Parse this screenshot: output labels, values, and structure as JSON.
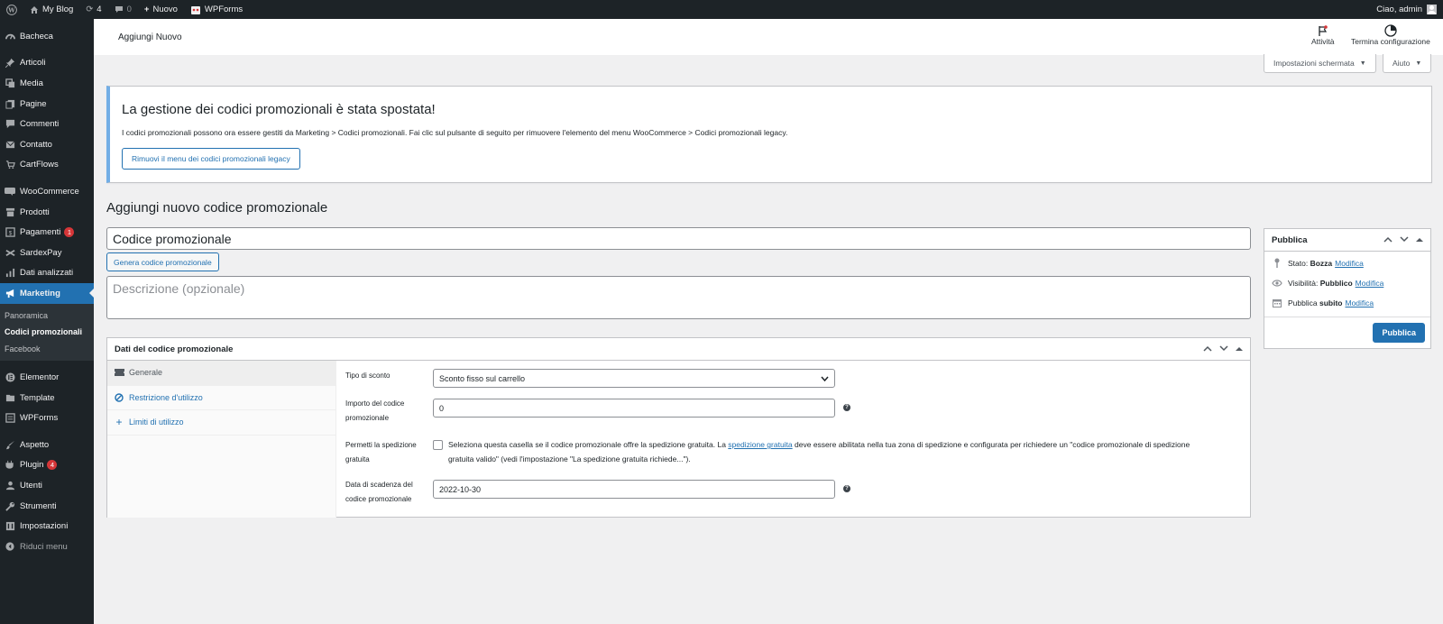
{
  "adminbar": {
    "site_name": "My Blog",
    "updates_count": "4",
    "comments_count": "0",
    "new_label": "Nuovo",
    "wpforms_label": "WPForms",
    "greeting": "Ciao, admin"
  },
  "sidebar": {
    "items": [
      {
        "label": "Bacheca",
        "icon": "dashboard-icon"
      },
      {
        "label": "Articoli",
        "icon": "pin-icon"
      },
      {
        "label": "Media",
        "icon": "media-icon"
      },
      {
        "label": "Pagine",
        "icon": "pages-icon"
      },
      {
        "label": "Commenti",
        "icon": "comment-icon"
      },
      {
        "label": "Contatto",
        "icon": "mail-icon"
      },
      {
        "label": "CartFlows",
        "icon": "cart-icon"
      },
      {
        "label": "WooCommerce",
        "icon": "woo-icon"
      },
      {
        "label": "Prodotti",
        "icon": "archive-icon"
      },
      {
        "label": "Pagamenti",
        "icon": "payment-icon",
        "badge": "1"
      },
      {
        "label": "SardexPay",
        "icon": "sardex-icon"
      },
      {
        "label": "Dati analizzati",
        "icon": "chart-icon"
      },
      {
        "label": "Marketing",
        "icon": "megaphone-icon"
      },
      {
        "label": "Elementor",
        "icon": "elementor-icon"
      },
      {
        "label": "Template",
        "icon": "folder-icon"
      },
      {
        "label": "WPForms",
        "icon": "form-icon"
      },
      {
        "label": "Aspetto",
        "icon": "brush-icon"
      },
      {
        "label": "Plugin",
        "icon": "plugin-icon",
        "badge": "4"
      },
      {
        "label": "Utenti",
        "icon": "user-icon"
      },
      {
        "label": "Strumenti",
        "icon": "wrench-icon"
      },
      {
        "label": "Impostazioni",
        "icon": "settings-icon"
      },
      {
        "label": "Riduci menu",
        "icon": "collapse-icon"
      }
    ],
    "submenu": [
      "Panoramica",
      "Codici promozionali",
      "Facebook"
    ]
  },
  "header": {
    "title": "Aggiungi Nuovo",
    "activity": "Attività",
    "finish_setup": "Termina configurazione"
  },
  "screen_options": {
    "screen_label": "Impostazioni schermata",
    "help_label": "Aiuto"
  },
  "notice": {
    "title": "La gestione dei codici promozionali è stata spostata!",
    "text": "I codici promozionali possono ora essere gestiti da Marketing > Codici promozionali. Fai clic sul pulsante di seguito per rimuovere l'elemento del menu WooCommerce > Codici promozionali legacy.",
    "button": "Rimuovi il menu dei codici promozionali legacy"
  },
  "page_title": "Aggiungi nuovo codice promozionale",
  "coupon_code_value": "Codice promozionale",
  "generate_button": "Genera codice promozionale",
  "description_placeholder": "Descrizione (opzionale)",
  "coupon_data": {
    "title": "Dati del codice promozionale",
    "tabs": [
      "Generale",
      "Restrizione d'utilizzo",
      "Limiti di utilizzo"
    ],
    "discount_type_label": "Tipo di sconto",
    "discount_type_value": "Sconto fisso sul carrello",
    "amount_label": "Importo del codice promozionale",
    "amount_value": "0",
    "free_shipping_label": "Permetti la spedizione gratuita",
    "free_shipping_text_1": "Seleziona questa casella se il codice promozionale offre la spedizione gratuita. La",
    "free_shipping_link": "spedizione gratuita",
    "free_shipping_text_2": "deve essere abilitata nella tua zona di spedizione e configurata per richiedere un \"codice promozionale di spedizione gratuita valido\" (vedi l'impostazione \"La spedizione gratuita richiede...\").",
    "expiry_label": "Data di scadenza del codice promozionale",
    "expiry_value": "2022-10-30"
  },
  "publish": {
    "title": "Pubblica",
    "status_label": "Stato:",
    "status_value": "Bozza",
    "visibility_label": "Visibilità:",
    "visibility_value": "Pubblico",
    "publish_label": "Pubblica",
    "publish_value": "subito",
    "edit_link": "Modifica",
    "button": "Pubblica"
  },
  "colors": {
    "accent": "#2271b1",
    "sidebar_bg": "#1d2327",
    "badge": "#d63638",
    "notice_border": "#72aee6"
  }
}
